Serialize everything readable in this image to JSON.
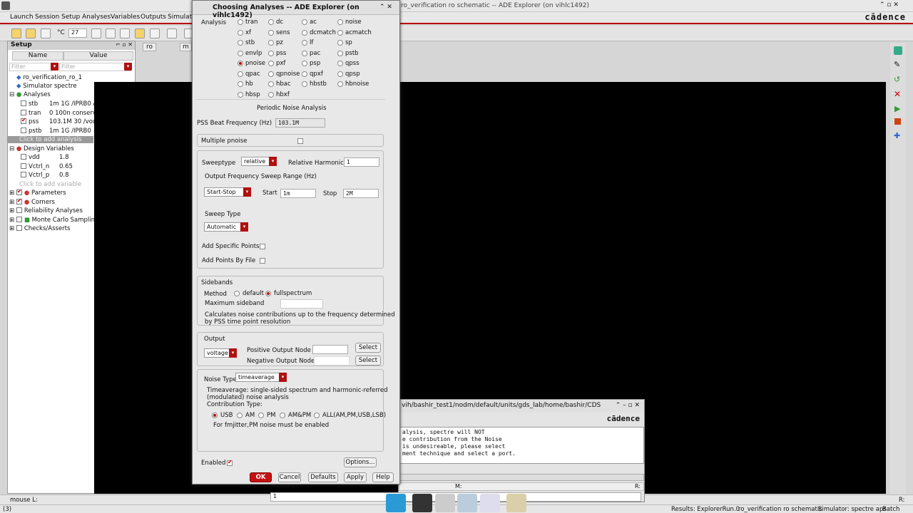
{
  "main": {
    "title": "ro_verification ro schematic -- ADE Explorer (on vihlc1492)",
    "brand": "cādence",
    "menus": [
      "Launch",
      "Session",
      "Setup",
      "Analyses",
      "Variables",
      "Outputs",
      "Simulati"
    ],
    "toolbar_value": "27",
    "tabs": [
      "ro",
      "m"
    ],
    "setup": {
      "title": "Setup",
      "col_name": "Name",
      "col_value": "Value",
      "filter_placeholder": "Filter",
      "test": "ro_verification_ro_1",
      "simulator_label": "Simulator",
      "simulator_value": "spectre",
      "analyses_label": "Analyses",
      "analyses": [
        {
          "name": "stb",
          "value": "1m 1G /IPRB0 Aut",
          "checked": false
        },
        {
          "name": "tran",
          "value": "0 100n conservat",
          "checked": false
        },
        {
          "name": "pss",
          "value": "103.1M 30 /vout",
          "checked": true
        },
        {
          "name": "pstb",
          "value": "1m 1G /IPRB0",
          "checked": false
        }
      ],
      "add_analysis": "Click to add analysis",
      "design_vars_label": "Design Variables",
      "design_vars": [
        {
          "name": "vdd",
          "value": "1.8"
        },
        {
          "name": "Vctrl_n",
          "value": "0.65"
        },
        {
          "name": "Vctrl_p",
          "value": "0.8"
        }
      ],
      "add_variable": "Click to add variable",
      "parameters": "Parameters",
      "corners": "Corners",
      "reliability": "Reliability Analyses",
      "monte_carlo": "Monte Carlo Sampling",
      "checks": "Checks/Asserts"
    },
    "status_left": "mouse L:",
    "status_num": "(3)",
    "status_right": "R:",
    "bottom_status": [
      "Results: ExplorerRun.0",
      "ro_verification ro schematic",
      "Simulator: spectre aps",
      "Batch"
    ]
  },
  "log": {
    "title": "vih/bashir_test1/nodm/default/units/gds_lab/home/bashir/CDS",
    "brand": "cādence",
    "lines": [
      "alysis, spectre will NOT",
      "e contribution from the Noise",
      "is undesireable, please select",
      "ment technique and select a port."
    ],
    "mouse_l": "mouse L:",
    "mouse_m": "M:",
    "mouse_r": "R:",
    "line_no": "1"
  },
  "dialog": {
    "title": "Choosing Analyses -- ADE Explorer (on vihlc1492)",
    "analysis_label": "Analysis",
    "analyses": [
      [
        "tran",
        "dc",
        "ac",
        "noise"
      ],
      [
        "xf",
        "sens",
        "dcmatch",
        "acmatch"
      ],
      [
        "stb",
        "pz",
        "lf",
        "sp"
      ],
      [
        "envlp",
        "pss",
        "pac",
        "pstb"
      ],
      [
        "pnoise",
        "pxf",
        "psp",
        "qpss"
      ],
      [
        "qpac",
        "qpnoise",
        "qpxf",
        "qpsp"
      ],
      [
        "hb",
        "hbac",
        "hbstb",
        "hbnoise"
      ],
      [
        "hbsp",
        "hbxf"
      ]
    ],
    "selected_analysis": "pnoise",
    "section_title": "Periodic Noise Analysis",
    "beat_label": "PSS Beat Frequency (Hz)",
    "beat_value": "103.1M",
    "multiple_pnoise": "Multiple pnoise",
    "sweeptype_label": "Sweeptype",
    "sweeptype_value": "relative",
    "rel_harmonic_label": "Relative Harmonic",
    "rel_harmonic_value": "1",
    "out_freq_label": "Output Frequency Sweep Range (Hz)",
    "range_value": "Start-Stop",
    "start_label": "Start",
    "start_value": "1m",
    "stop_label": "Stop",
    "stop_value": "2M",
    "sweep_type_label": "Sweep Type",
    "sweep_type_value": "Automatic",
    "add_specific": "Add Specific Points",
    "add_by_file": "Add Points By File",
    "sidebands_label": "Sidebands",
    "method_label": "Method",
    "method_default": "default",
    "method_full": "fullspectrum",
    "max_sideband": "Maximum sideband",
    "sideband_note1": "Calculates noise contributions up to the frequency determined",
    "sideband_note2": "by PSS time point resolution",
    "output_label": "Output",
    "output_type": "voltage",
    "pos_node": "Positive Output Node",
    "neg_node": "Negative Output Node",
    "select_label": "Select",
    "noise_type_label": "Noise Type",
    "noise_type_value": "timeaverage",
    "noise_desc1": "Timeaverage: single-sided spectrum and harmonic-referred",
    "noise_desc2": "(modulated) noise analysis",
    "contribution_label": "Contribution Type:",
    "contrib": [
      "USB",
      "AM",
      "PM",
      "AM&PM",
      "ALL(AM,PM,USB,LSB)"
    ],
    "fmjitter_note": "For fmjitter,PM noise must be enabled",
    "enabled_label": "Enabled",
    "options_btn": "Options...",
    "ok_btn": "OK",
    "cancel_btn": "Cancel",
    "defaults_btn": "Defaults",
    "apply_btn": "Apply",
    "help_btn": "Help"
  }
}
